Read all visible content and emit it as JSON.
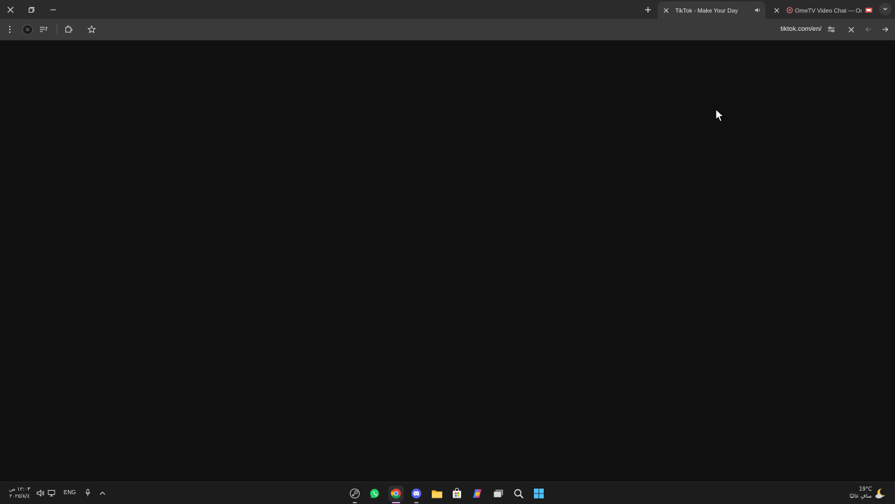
{
  "window_controls": {
    "close": "close-icon",
    "restore": "restore-icon",
    "minimize": "minimize-icon"
  },
  "tabs": [
    {
      "title": "TikTok - Make Your Day",
      "active": true,
      "audio": true
    },
    {
      "title": "OmeTV Video Chat — Ome",
      "active": false,
      "camera": true
    }
  ],
  "toolbar": {
    "url": "tiktok.com/en/",
    "profile_initials": "S/"
  },
  "taskbar": {
    "time": "١٢:٠٣ ص",
    "date": "٢٠٢٥/٨/٤",
    "language": "ENG",
    "weather_temp": "19°C",
    "weather_desc": "صافٍ غالبًا",
    "apps": [
      "steam",
      "whatsapp",
      "chrome",
      "discord",
      "file-explorer",
      "microsoft-store",
      "copilot",
      "task-view",
      "search",
      "start"
    ]
  },
  "colors": {
    "page_background": "#101010",
    "tab_strip": "#2b2b2b",
    "toolbar": "#3a3a3a",
    "taskbar": "#1c1c1c"
  }
}
